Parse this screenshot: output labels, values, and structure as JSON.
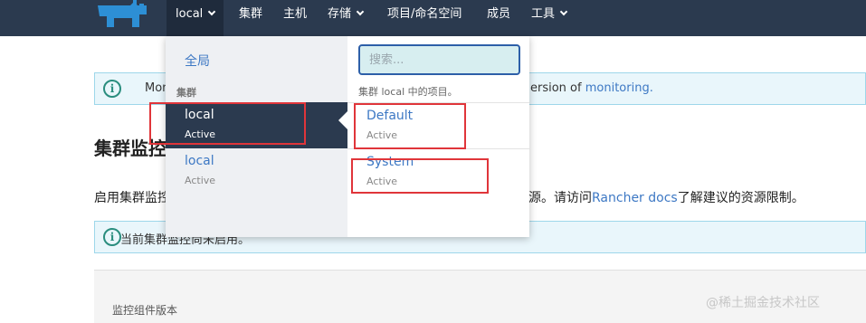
{
  "nav": {
    "cluster_selector": "local",
    "items": [
      "集群",
      "主机",
      "存储",
      "项目/命名空间",
      "成员",
      "工具"
    ]
  },
  "banner1": {
    "text_left": "Mon",
    "text_right": "ersion of",
    "link": "monitoring."
  },
  "page": {
    "heading": "集群监控",
    "description_left": "启用集群监控",
    "description_right_prefix": "源。请访问",
    "description_link": "Rancher docs",
    "description_right_suffix": "了解建议的资源限制。"
  },
  "banner2": {
    "text": "当前集群监控尚未启用。"
  },
  "panel": {
    "label": "监控组件版本"
  },
  "dropdown": {
    "global_label": "全局",
    "cluster_section_label": "集群",
    "clusters": [
      {
        "name": "local",
        "state": "Active",
        "selected": true
      },
      {
        "name": "local",
        "state": "Active",
        "selected": false
      }
    ],
    "search_placeholder": "搜索...",
    "projects_label": "集群 local 中的项目。",
    "projects": [
      {
        "name": "Default",
        "state": "Active"
      },
      {
        "name": "System",
        "state": "Active"
      }
    ]
  },
  "watermark": "@稀土掘金技术社区",
  "colors": {
    "nav_bg": "#2b3a4f",
    "accent": "#3d78c4",
    "highlight_box": "#e0353a",
    "info_bg": "#e9f6fb"
  }
}
